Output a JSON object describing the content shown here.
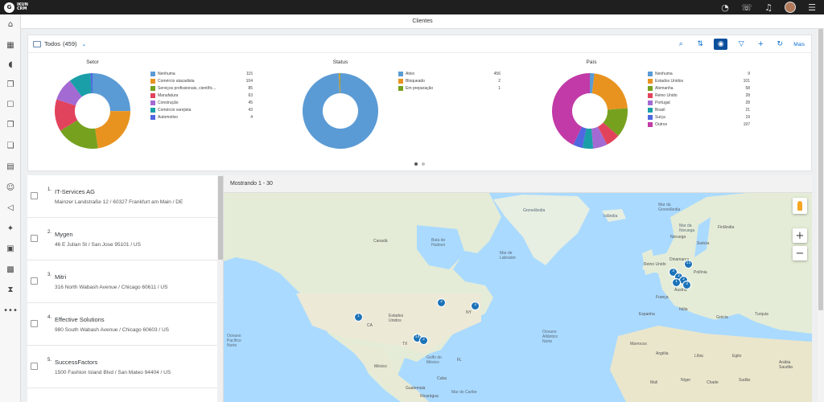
{
  "app": {
    "logo_mark": "G",
    "logo_text_line1": "IKUN",
    "logo_text_line2": "CRM"
  },
  "page_title": "Clientes",
  "filter": {
    "label": "Todos",
    "count": "(459)"
  },
  "toolbar": {
    "more_label": "Mais"
  },
  "charts": {
    "setor": {
      "title": "Setor",
      "items": [
        {
          "label": "Nenhuma",
          "value": "115",
          "color": "#5b9bd5"
        },
        {
          "label": "Comércio atacadista",
          "value": "104",
          "color": "#e8931f"
        },
        {
          "label": "Serviços profissionais, científic...",
          "value": "85",
          "color": "#76a11f"
        },
        {
          "label": "Manufatura",
          "value": "63",
          "color": "#e2435c"
        },
        {
          "label": "Construção",
          "value": "45",
          "color": "#a46ad3"
        },
        {
          "label": "Comércio varejista",
          "value": "43",
          "color": "#1a9fa9"
        },
        {
          "label": "Automotivo",
          "value": "4",
          "color": "#4f67e0"
        }
      ]
    },
    "status": {
      "title": "Status",
      "items": [
        {
          "label": "Ativo",
          "value": "456",
          "color": "#5b9bd5"
        },
        {
          "label": "Bloqueado",
          "value": "2",
          "color": "#e8931f"
        },
        {
          "label": "Em preparação",
          "value": "1",
          "color": "#76a11f"
        }
      ]
    },
    "pais": {
      "title": "País",
      "items": [
        {
          "label": "Nenhuma",
          "value": "9",
          "color": "#5b9bd5"
        },
        {
          "label": "Estados Unidos",
          "value": "101",
          "color": "#e8931f"
        },
        {
          "label": "Alemanha",
          "value": "58",
          "color": "#76a11f"
        },
        {
          "label": "Reino Unido",
          "value": "28",
          "color": "#e2435c"
        },
        {
          "label": "Portugal",
          "value": "28",
          "color": "#a46ad3"
        },
        {
          "label": "Brasil",
          "value": "21",
          "color": "#1a9fa9"
        },
        {
          "label": "Suíça",
          "value": "19",
          "color": "#4f67e0"
        },
        {
          "label": "Outros",
          "value": "197",
          "color": "#c13aa7"
        }
      ]
    }
  },
  "customers": [
    {
      "num": "1.",
      "name": "IT-Services AG",
      "address": "Mainzer Landstraße 12 / 60327 Frankfurt am Main / DE"
    },
    {
      "num": "2.",
      "name": "Mygen",
      "address": "46 E Julian St / San Jose 95101 / US"
    },
    {
      "num": "3.",
      "name": "Mitri",
      "address": "316 North Wabash Avenue / Chicago 60611 / US"
    },
    {
      "num": "4.",
      "name": "Effective Solutions",
      "address": "980 South Wabash Avenue / Chicago 60603 / US"
    },
    {
      "num": "5.",
      "name": "SuccessFactors",
      "address": "1500 Fashion Island Blvd / San Mateo 94404 / US"
    }
  ],
  "map": {
    "showing": "Mostrando 1 - 30",
    "zoom_in": "+",
    "zoom_out": "−",
    "labels": {
      "groenlandia": "Gronelândia",
      "islandia": "Islândia",
      "canada": "Canadá",
      "baia_hudson": "Baía de\nHudson",
      "mar_labrador": "Mar de\nLabrador",
      "eua": "Estados\nUnidos",
      "mexico": "México",
      "golfo_mexico": "Golfo do\nMéxico",
      "oceano_pacifico": "Oceano\nPacífico\nNorte",
      "oceano_atlantico": "Oceano\nAtlântico\nNorte",
      "noruega": "Noruega",
      "finlandia": "Finlândia",
      "suecia": "Suécia",
      "reino_unido": "Reino Unido",
      "polonia": "Polônia",
      "franca": "França",
      "espanha": "Espanha",
      "marrocos": "Marrocos",
      "argelia": "Argélia",
      "libia": "Líbia",
      "egito": "Egito",
      "mali": "Mali",
      "niger": "Níger",
      "chade": "Chade",
      "sudao": "Sudão",
      "arabia": "Arábia\nSaudita",
      "mar_groenlandia": "Mar da\nGronelândia",
      "mar_noruega": "Mar da\nNoruega",
      "dinamarca": "Dinamarca",
      "austria": "Áustria",
      "italia": "Itália",
      "cuba": "Cuba",
      "guatemala": "Guatemala",
      "nicaragua": "Nicarágua",
      "turquia": "Turquia",
      "grecia": "Grécia",
      "mar_caribe": "Mar do Caribe",
      "ny": "NY",
      "ca": "CA",
      "tx": "TX",
      "fl": "FL"
    },
    "pins": [
      "1",
      "2",
      "3",
      "14",
      "2",
      "15",
      "3",
      "2",
      "2",
      "1",
      "3"
    ]
  }
}
